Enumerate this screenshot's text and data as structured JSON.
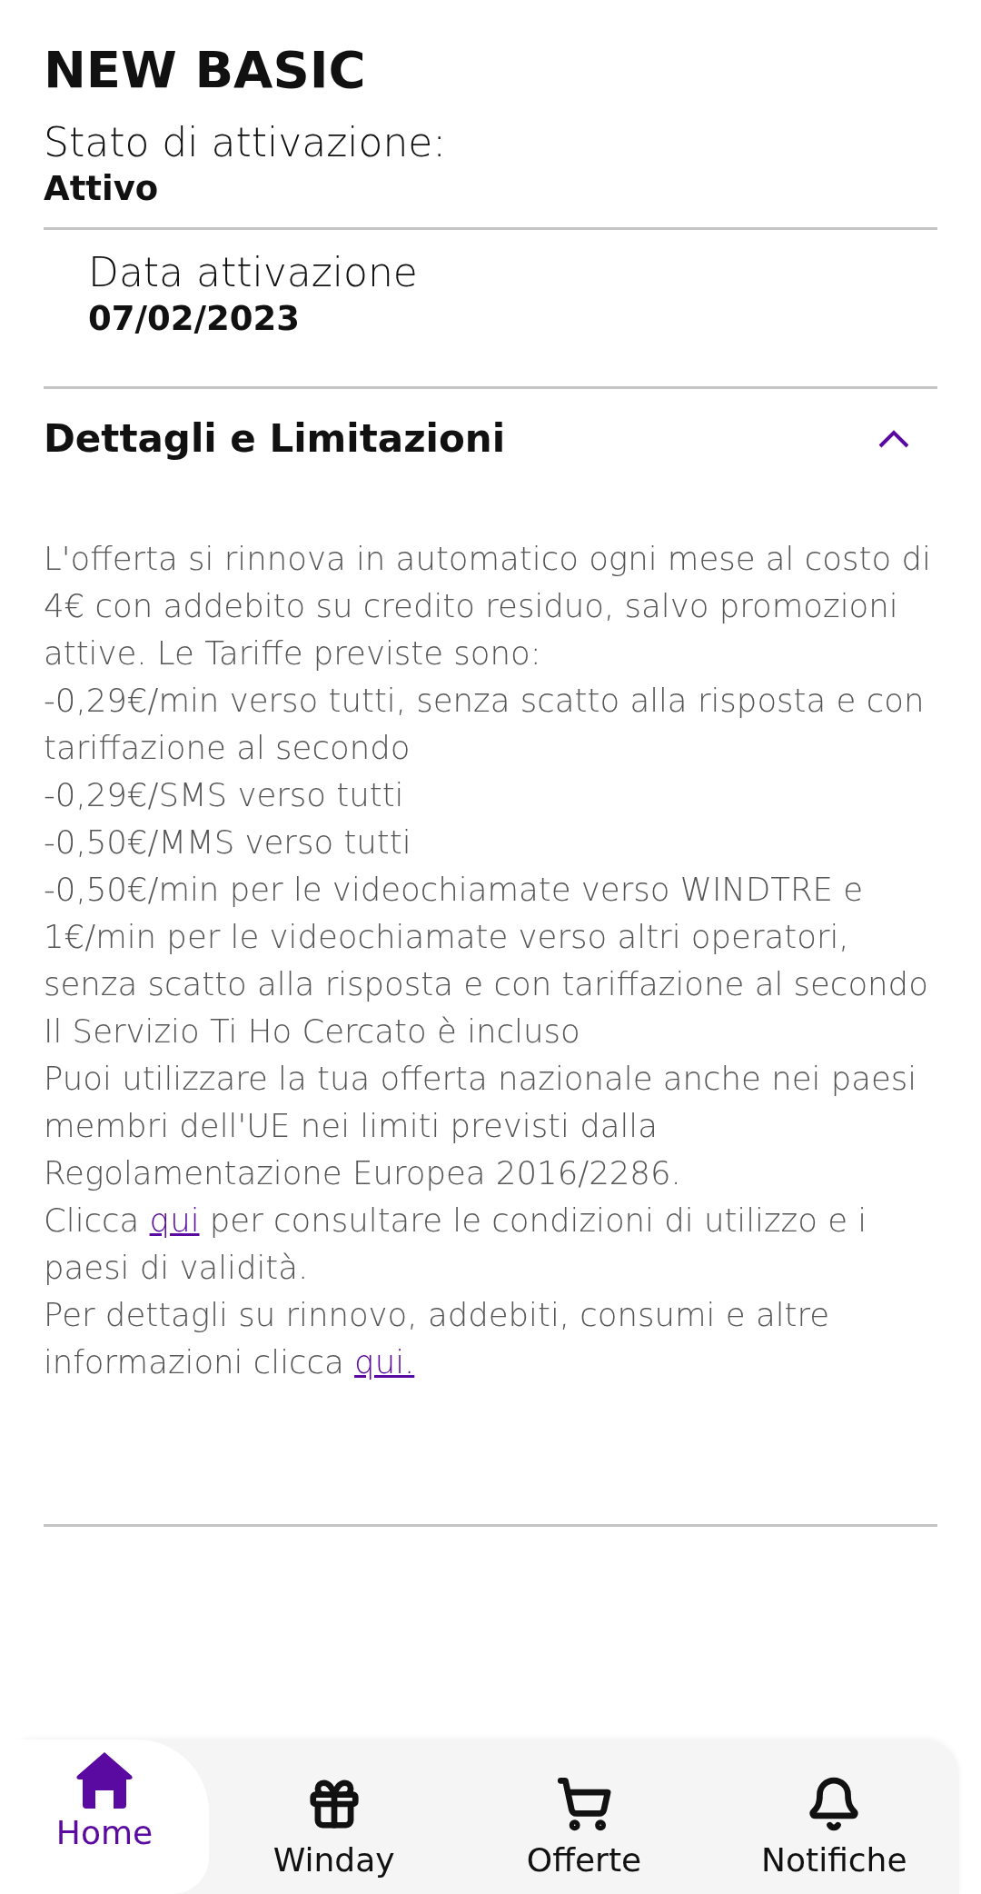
{
  "title": "NEW BASIC",
  "status": {
    "label": "Stato di attivazione:",
    "value": "Attivo"
  },
  "activation": {
    "label": "Data attivazione",
    "value": "07/02/2023"
  },
  "details": {
    "title": "Dettagli e Limitazioni",
    "expanded": true,
    "paragraphs": [
      {
        "text": "L'offerta si rinnova in automatico ogni mese al costo di 4€ con addebito su credito residuo, salvo promozioni attive. Le Tariffe previste sono:"
      },
      {
        "text": "-0,29€/min verso tutti, senza scatto alla risposta e con tariffazione al secondo"
      },
      {
        "text": "-0,29€/SMS verso tutti"
      },
      {
        "text": "-0,50€/MMS verso tutti"
      },
      {
        "text": "-0,50€/min per le videochiamate verso WINDTRE e 1€/min per le videochiamate verso altri operatori, senza scatto alla risposta e con tariffazione al secondo"
      },
      {
        "text": "Il Servizio Ti Ho Cercato è incluso"
      },
      {
        "text": "Puoi utilizzare la tua offerta nazionale anche nei paesi membri dell'UE nei limiti previsti dalla Regolamentazione Europea 2016/2286."
      },
      {
        "text": "Clicca",
        "link": "qui",
        "after": "per consultare le condizioni di utilizzo e i paesi di validità."
      },
      {
        "text": "Per dettagli su rinnovo, addebiti, consumi e altre informazioni clicca",
        "link": "qui."
      }
    ]
  },
  "nav": [
    {
      "label": "Home",
      "selected": true
    },
    {
      "label": "Winday",
      "selected": false
    },
    {
      "label": "Offerte",
      "selected": false
    },
    {
      "label": "Notifiche",
      "selected": false
    }
  ]
}
